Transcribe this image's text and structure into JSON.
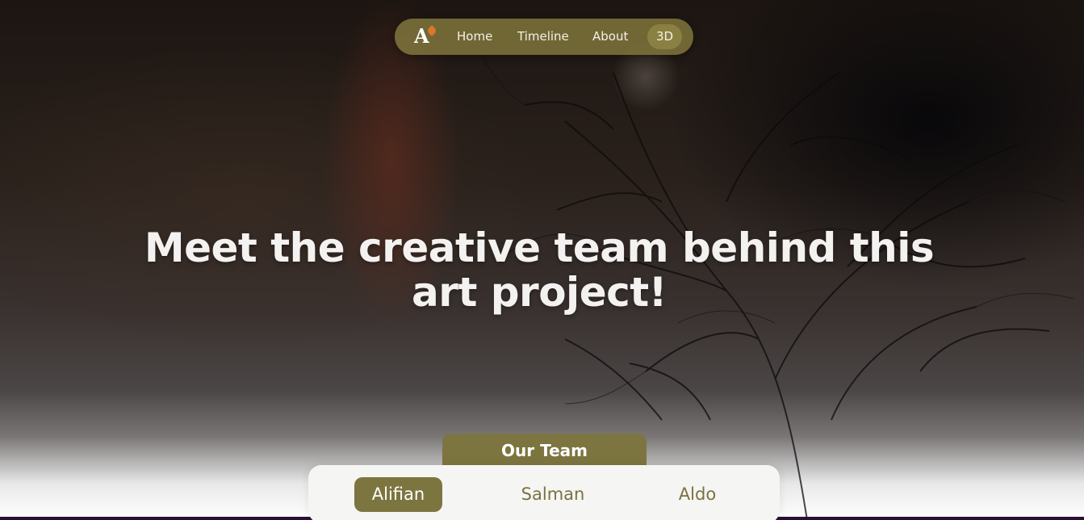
{
  "nav": {
    "logo_text": "A",
    "links": [
      {
        "label": "Home"
      },
      {
        "label": "Timeline"
      },
      {
        "label": "About"
      },
      {
        "label": "3D",
        "active": true
      }
    ]
  },
  "hero": {
    "line1": "Meet the creative team behind this",
    "line2": "art project!"
  },
  "team": {
    "tab_label": "Our Team",
    "members": [
      {
        "name": "Alifian",
        "active": true
      },
      {
        "name": "Salman",
        "active": false
      },
      {
        "name": "Aldo",
        "active": false
      }
    ]
  },
  "colors": {
    "accent": "#7d7540",
    "nav_bg": "#80763c",
    "heading_text": "#f4f2f0",
    "panel_bg": "#f5f5f4"
  }
}
